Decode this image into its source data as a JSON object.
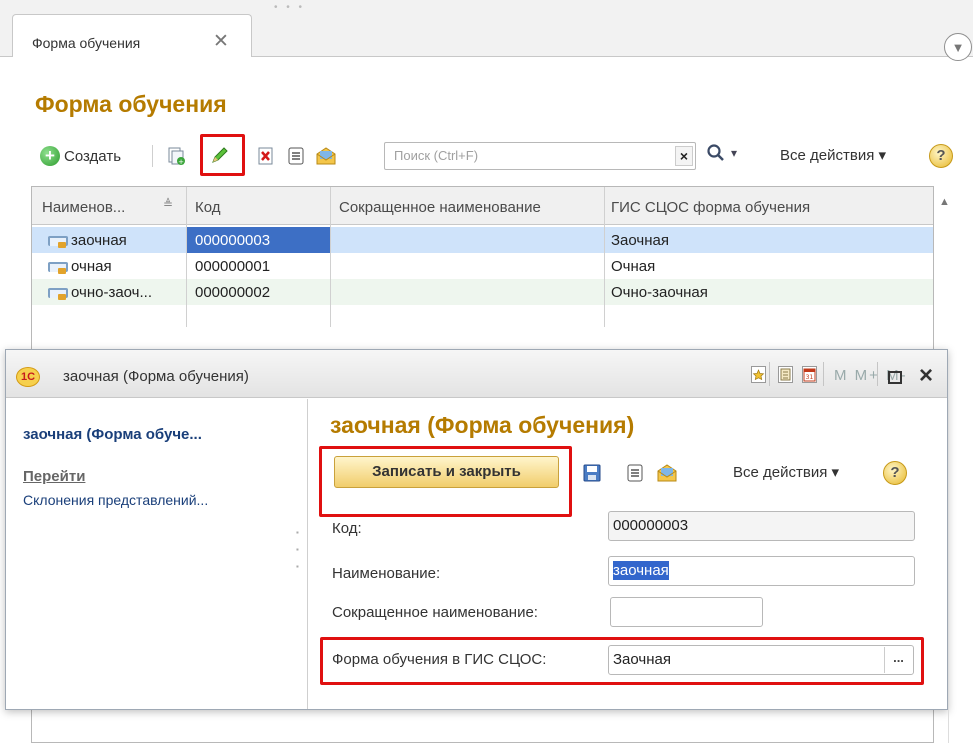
{
  "main": {
    "tab": {
      "label": "Форма обучения",
      "close_glyph": "✕"
    },
    "title": "Форма обучения",
    "toolbar": {
      "create_label": "Создать",
      "search_placeholder": "Поиск (Ctrl+F)",
      "search_clear": "×",
      "search_dropdown": "▾",
      "all_actions_label": "Все действия ▾",
      "help_label": "?"
    },
    "table": {
      "columns": [
        "Наименов...",
        "Код",
        "Сокращенное наименование",
        "ГИС СЦОС форма обучения"
      ],
      "rows": [
        {
          "name": "заочная",
          "code": "000000003",
          "short": "",
          "gis": "Заочная"
        },
        {
          "name": "очная",
          "code": "000000001",
          "short": "",
          "gis": "Очная"
        },
        {
          "name": "очно-заоч...",
          "code": "000000002",
          "short": "",
          "gis": "Очно-заочная"
        }
      ]
    }
  },
  "dialog": {
    "title": "заочная (Форма обучения)",
    "logo": "1C",
    "title_controls": "M  M+  M-",
    "nav": {
      "current": "заочная (Форма обуче...",
      "goto": "Перейти",
      "link": "Склонения представлений..."
    },
    "heading": "заочная (Форма обучения)",
    "save_close_label": "Записать и закрыть",
    "all_actions_label": "Все действия ▾",
    "help_label": "?",
    "fields": {
      "code_label": "Код:",
      "code_value": "000000003",
      "name_label": "Наименование:",
      "name_value": "заочная",
      "short_label": "Сокращенное наименование:",
      "short_value": "",
      "gis_label": "Форма обучения в ГИС СЦОС:",
      "gis_value": "Заочная",
      "gis_button": "..."
    }
  },
  "colors": {
    "title_accent": "#b57b00",
    "highlight_red": "#e01010",
    "selection_blue": "#3d6fc5",
    "row_selected": "#cfe3fa"
  }
}
